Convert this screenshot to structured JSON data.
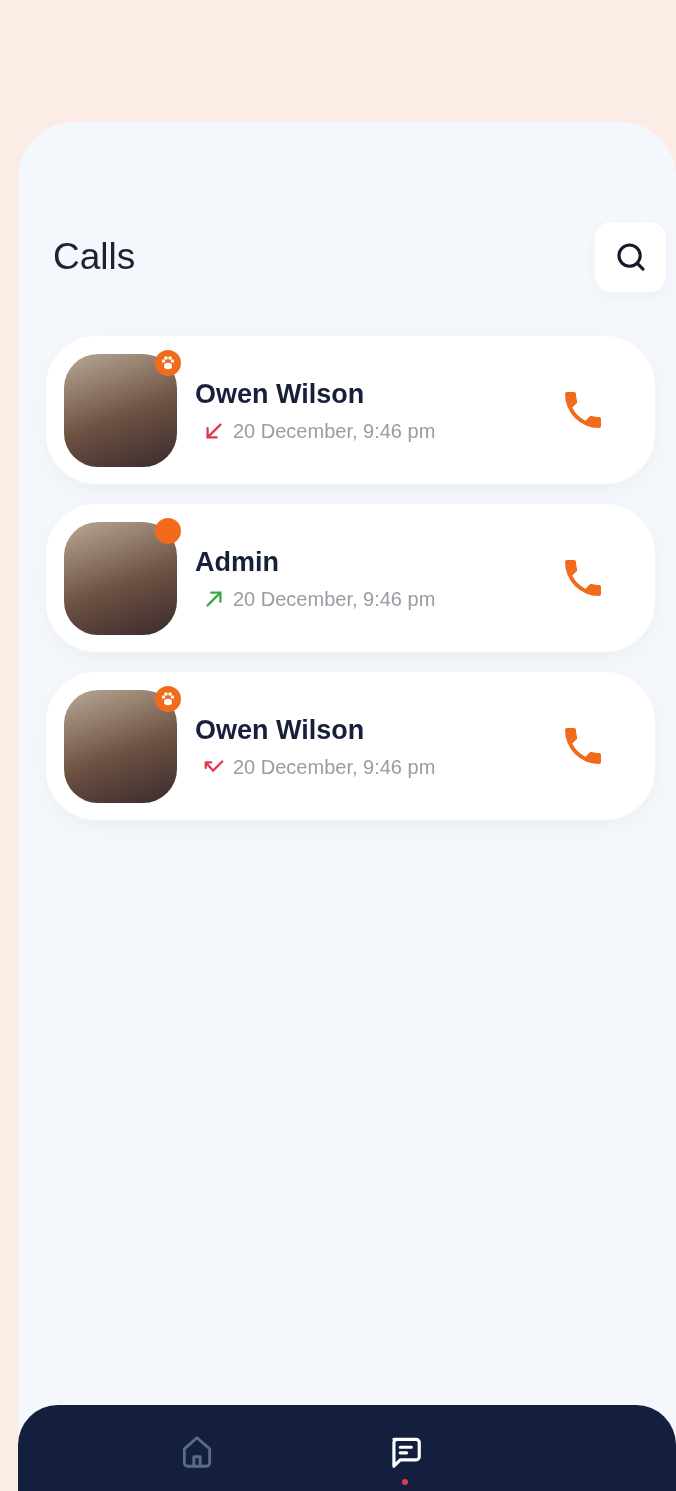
{
  "header": {
    "title": "Calls"
  },
  "calls": [
    {
      "name": "Owen Wilson",
      "time": "20 December, 9:46 pm",
      "kind": "incoming",
      "badge": {
        "kind": "paw"
      }
    },
    {
      "name": "Admin",
      "time": "20 December, 9:46 pm",
      "kind": "outgoing",
      "badge": {
        "kind": "dot"
      }
    },
    {
      "name": "Owen Wilson",
      "time": "20 December, 9:46 pm",
      "kind": "missed",
      "badge": {
        "kind": "paw"
      }
    }
  ],
  "nav": [
    {
      "kind": "home",
      "selected": false
    },
    {
      "kind": "chat",
      "selected": true
    }
  ]
}
